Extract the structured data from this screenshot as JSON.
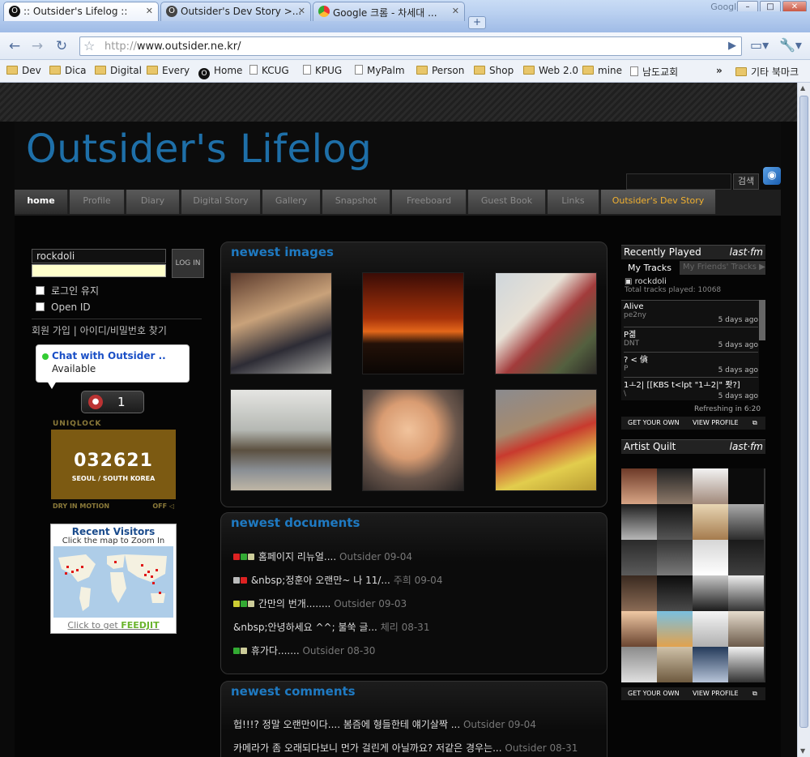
{
  "browser": {
    "google_label": "Google",
    "tabs": [
      {
        "title": "Outsider's Lifelog ::",
        "prefix": ":: "
      },
      {
        "title": "Outsider's Dev Story >..."
      },
      {
        "title": "Google 크롬 - 차세대 ..."
      }
    ],
    "url_protocol": "http://",
    "url_host": "www.outsider.ne.kr/",
    "bookmarks": [
      "Dev",
      "Dica",
      "Digital",
      "Every",
      "Home",
      "KCUG",
      "KPUG",
      "MyPalm",
      "Person",
      "Shop",
      "Web 2.0",
      "mine",
      "남도교회"
    ],
    "other_bookmarks": "기타 북마크",
    "more": "»"
  },
  "site": {
    "title": "Outsider's Lifelog",
    "search_button": "검색",
    "menu": [
      "home",
      "Profile",
      "Diary",
      "Digital Story",
      "Gallery",
      "Snapshot",
      "Freeboard",
      "Guest Book",
      "Links",
      "Outsider's Dev Story"
    ]
  },
  "login": {
    "username": "rockdoli",
    "login_button": "LOG IN",
    "keep_login": "로그인 유지",
    "open_id": "Open ID",
    "join": "회원 가입",
    "find": "아이디/비밀번호 찾기"
  },
  "chat": {
    "name": "Chat with Outsider ..",
    "status": "Available"
  },
  "counter": {
    "value": "1"
  },
  "uniqlock": {
    "label": "UNIQLOCK",
    "time": "032621",
    "city": "SEOUL / SOUTH KOREA",
    "footer": "DRY IN MOTION",
    "off": "OFF"
  },
  "visitors": {
    "title": "Recent Visitors",
    "subtitle": "Click the map to Zoom In",
    "footer_prefix": "Click to get",
    "footer_brand": "FEEDJIT"
  },
  "images_panel": {
    "title": "newest images"
  },
  "documents_panel": {
    "title": "newest documents",
    "items": [
      {
        "text": "홈페이지 리뉴얼....",
        "meta": "Outsider 09-04"
      },
      {
        "text": "&nbsp;정훈아 오랜만~ 나 11/...",
        "meta": "주희 09-04"
      },
      {
        "text": "간만의 번개........",
        "meta": "Outsider 09-03"
      },
      {
        "text": "&nbsp;안녕하세요 ^^; 불쑥 글...",
        "meta": "체리 08-31"
      },
      {
        "text": "휴가다.......",
        "meta": "Outsider 08-30"
      }
    ]
  },
  "comments_panel": {
    "title": "newest comments",
    "items": [
      {
        "text": "헙!!!? 정말 오랜만이다.... 봄즘에 형들한테 얘기살짝 ...",
        "meta": "Outsider 09-04"
      },
      {
        "text": "카메라가 좀 오래되다보니 먼가 걸린게 아닐까요? 저같은 경우는...",
        "meta": "Outsider 08-31"
      }
    ]
  },
  "lastfm": {
    "recent_title": "Recently Played",
    "logo": "last·fm",
    "tab_mine": "My Tracks",
    "tab_friends": "My Friends' Tracks",
    "user": "rockdoli",
    "total": "Total tracks played: 10068",
    "tracks": [
      {
        "title": "Alive",
        "artist": "pe2ny",
        "ago": "5 days ago"
      },
      {
        "title": "P곎",
        "artist": "DNT",
        "ago": "5 days ago"
      },
      {
        "title": "? < 僋",
        "artist": "P",
        "ago": "5 days ago"
      },
      {
        "title": "1ㅗ2| [[KBS t<lpt \"1ㅗ2|\" 퐛?]",
        "artist": "\\",
        "ago": "5 days ago"
      }
    ],
    "refreshing": "Refreshing in 6:20",
    "get_your_own": "GET YOUR OWN",
    "view_profile": "VIEW PROFILE",
    "quilt_title": "Artist Quilt"
  }
}
